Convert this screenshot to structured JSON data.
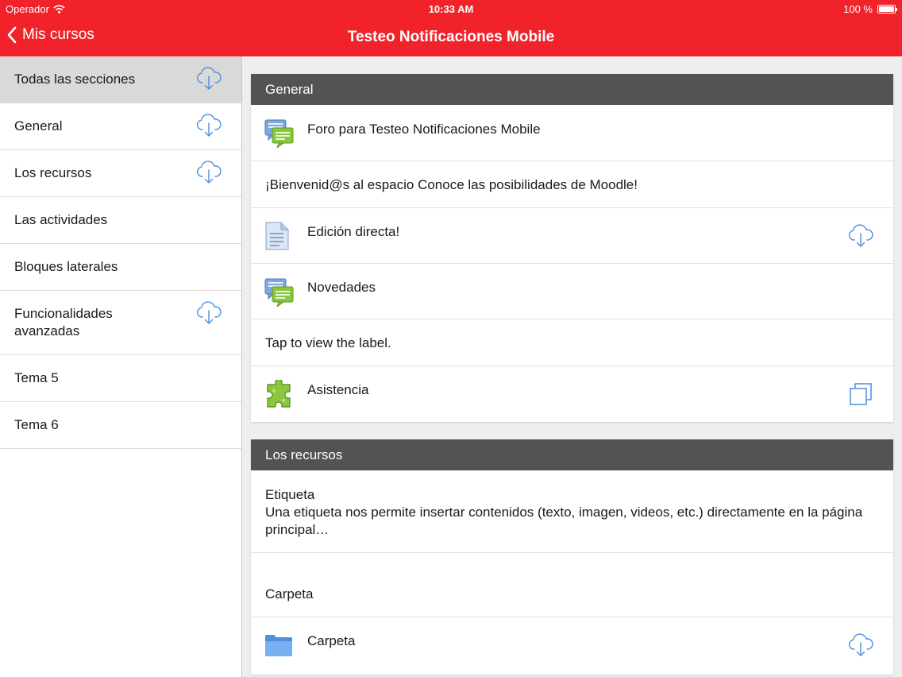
{
  "status": {
    "carrier": "Operador",
    "time": "10:33 AM",
    "battery": "100 %"
  },
  "nav": {
    "back_label": "Mis cursos",
    "title": "Testeo Notificaciones Mobile"
  },
  "colors": {
    "brand": "#f2222b",
    "section_header": "#535353",
    "selected_row": "#d9d9d9",
    "icon_blue": "#4a90d9"
  },
  "sidebar": {
    "items": [
      {
        "label": "Todas las secciones",
        "download": true,
        "selected": true
      },
      {
        "label": "General",
        "download": true
      },
      {
        "label": "Los recursos",
        "download": true
      },
      {
        "label": "Las actividades",
        "download": false
      },
      {
        "label": "Bloques laterales",
        "download": false
      },
      {
        "label": "Funcionalidades avanzadas",
        "download": true
      },
      {
        "label": "Tema 5",
        "download": false
      },
      {
        "label": "Tema 6",
        "download": false
      }
    ]
  },
  "sections": [
    {
      "title": "General",
      "modules": [
        {
          "type": "forum",
          "icon": "forum-icon",
          "name": "Foro para Testeo Notificaciones Mobile"
        },
        {
          "type": "label",
          "name": "¡Bienvenid@s al espacio Conoce las posibilidades de Moodle!"
        },
        {
          "type": "page",
          "icon": "page-icon",
          "name": "Edición directa!",
          "action_icon": "download-cloud-icon"
        },
        {
          "type": "forum",
          "icon": "forum-icon",
          "name": "Novedades"
        },
        {
          "type": "label",
          "name": "Tap to view the label."
        },
        {
          "type": "plugin",
          "icon": "puzzle-icon",
          "name": "Asistencia",
          "action_icon": "open-external-icon"
        }
      ]
    },
    {
      "title": "Los recursos",
      "modules": [
        {
          "type": "label",
          "title": "Etiqueta",
          "text": "Una etiqueta nos permite insertar contenidos (texto, imagen, videos, etc.) directamente en la página principal…"
        },
        {
          "type": "label",
          "name": "Carpeta"
        },
        {
          "type": "folder",
          "icon": "folder-icon",
          "name": "Carpeta",
          "action_icon": "download-cloud-icon"
        }
      ]
    }
  ]
}
